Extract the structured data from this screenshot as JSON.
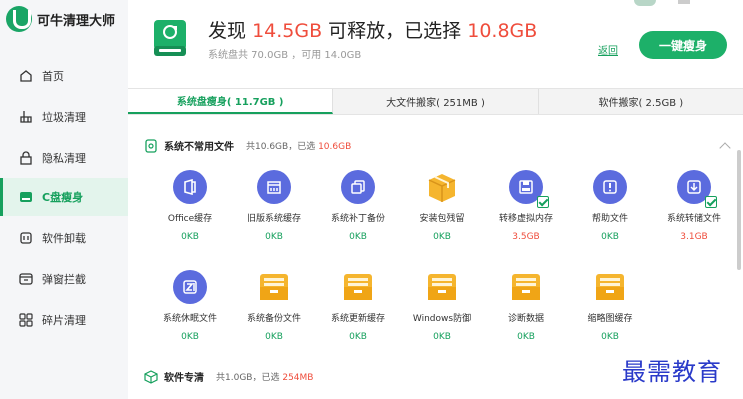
{
  "app": {
    "title": "可牛清理大师"
  },
  "sidebar": {
    "items": [
      {
        "label": "首页",
        "icon": "home-icon"
      },
      {
        "label": "垃圾清理",
        "icon": "broom-icon"
      },
      {
        "label": "隐私清理",
        "icon": "lock-icon"
      },
      {
        "label": "C盘瘦身",
        "icon": "disk-icon"
      },
      {
        "label": "软件卸载",
        "icon": "trash-icon"
      },
      {
        "label": "弹窗拦截",
        "icon": "popup-block-icon"
      },
      {
        "label": "碎片清理",
        "icon": "grid-icon"
      }
    ]
  },
  "header": {
    "prefix": "发现",
    "found": "14.5GB",
    "mid": "可释放，已选择",
    "selected": "10.8GB",
    "sub": "系统盘共 70.0GB ，可用 14.0GB",
    "back": "返回",
    "action": "一键瘦身"
  },
  "tabs": [
    {
      "label": "系统盘瘦身( 11.7GB )"
    },
    {
      "label": "大文件搬家( 251MB )"
    },
    {
      "label": "软件搬家( 2.5GB )"
    }
  ],
  "section1": {
    "title": "系统不常用文件",
    "meta_prefix": "共10.6GB，已选",
    "meta_selected": "10.6GB"
  },
  "items": [
    {
      "label": "Office缓存",
      "size": "0KB",
      "icon": "office-icon"
    },
    {
      "label": "旧版系统缓存",
      "size": "0KB",
      "icon": "calendar-icon"
    },
    {
      "label": "系统补丁备份",
      "size": "0KB",
      "icon": "copy-icon"
    },
    {
      "label": "安装包残留",
      "size": "0KB",
      "icon": "package-icon"
    },
    {
      "label": "转移虚拟内存",
      "size": "3.5GB",
      "icon": "memory-icon"
    },
    {
      "label": "帮助文件",
      "size": "0KB",
      "icon": "help-icon"
    },
    {
      "label": "系统转储文件",
      "size": "3.1GB",
      "icon": "download-icon"
    },
    {
      "label": "系统休眠文件",
      "size": "0KB",
      "icon": "sleep-icon"
    },
    {
      "label": "系统备份文件",
      "size": "0KB",
      "icon": "folder-icon"
    },
    {
      "label": "系统更新缓存",
      "size": "0KB",
      "icon": "folder-icon"
    },
    {
      "label": "Windows防御",
      "size": "0KB",
      "icon": "folder-icon"
    },
    {
      "label": "诊断数据",
      "size": "0KB",
      "icon": "folder-icon"
    },
    {
      "label": "缩略图缓存",
      "size": "0KB",
      "icon": "folder-icon"
    }
  ],
  "section2": {
    "title": "软件专清",
    "meta_prefix": "共1.0GB，已选",
    "meta_selected": "254MB"
  },
  "watermark": "最需教育",
  "colors": {
    "accent": "#16a05d",
    "danger": "#ef4d3c",
    "icon": "#5b6bde",
    "folder": "#f5b52e"
  }
}
